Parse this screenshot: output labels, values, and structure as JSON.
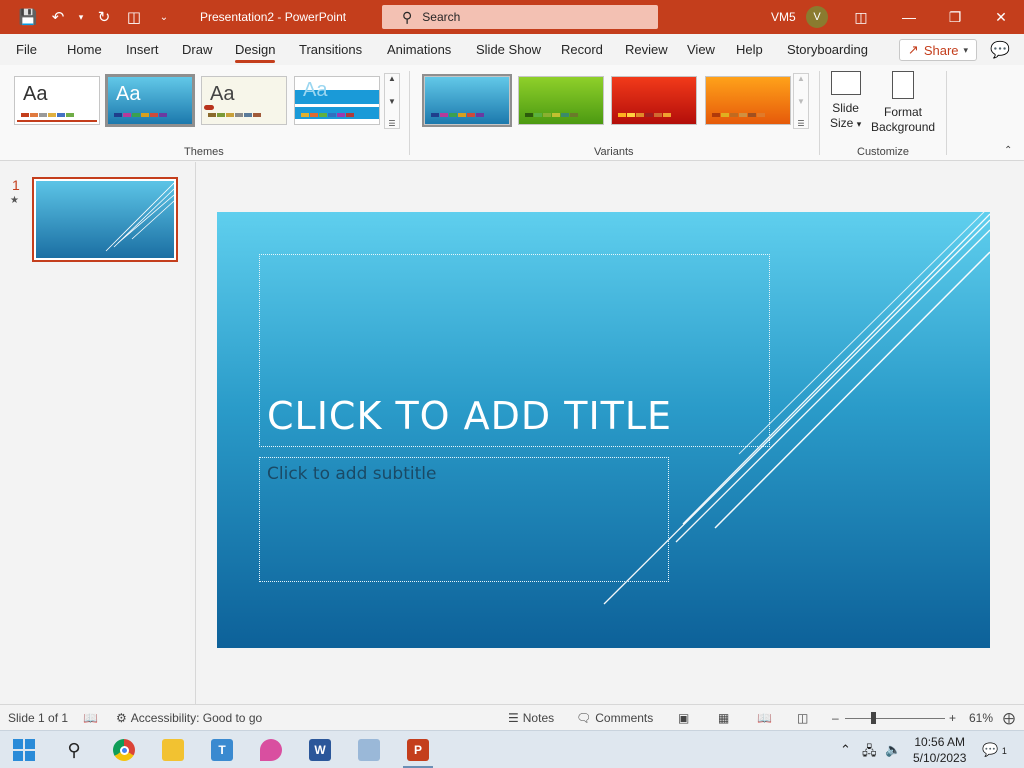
{
  "titlebar": {
    "doc_title": "Presentation2  -  PowerPoint",
    "search_placeholder": "Search",
    "user": "VM5",
    "avatar_initial": "V"
  },
  "tabs": [
    {
      "label": "File"
    },
    {
      "label": "Home"
    },
    {
      "label": "Insert"
    },
    {
      "label": "Draw"
    },
    {
      "label": "Design"
    },
    {
      "label": "Transitions"
    },
    {
      "label": "Animations"
    },
    {
      "label": "Slide Show"
    },
    {
      "label": "Record"
    },
    {
      "label": "Review"
    },
    {
      "label": "View"
    },
    {
      "label": "Help"
    },
    {
      "label": "Storyboarding"
    }
  ],
  "active_tab": "Design",
  "share_label": "Share",
  "ribbon": {
    "themes_label": "Themes",
    "variants_label": "Variants",
    "customize_label": "Customize",
    "theme_sample_text": "Aa",
    "slide_size_line1": "Slide",
    "slide_size_line2": "Size",
    "format_bg_line1": "Format",
    "format_bg_line2": "Background"
  },
  "slides_pane": {
    "slide_number": "1"
  },
  "slide": {
    "title_placeholder": "CLICK TO ADD TITLE",
    "subtitle_placeholder": "Click to add subtitle"
  },
  "statusbar": {
    "slide_info": "Slide 1 of 1",
    "accessibility": "Accessibility: Good to go",
    "notes": "Notes",
    "comments": "Comments",
    "zoom": "61%"
  },
  "taskbar": {
    "time": "10:56 AM",
    "date": "5/10/2023",
    "notification_count": "1"
  },
  "colors": {
    "accent": "#c43e1c",
    "slide_top": "#5fcfee",
    "slide_bottom": "#0d6199"
  }
}
